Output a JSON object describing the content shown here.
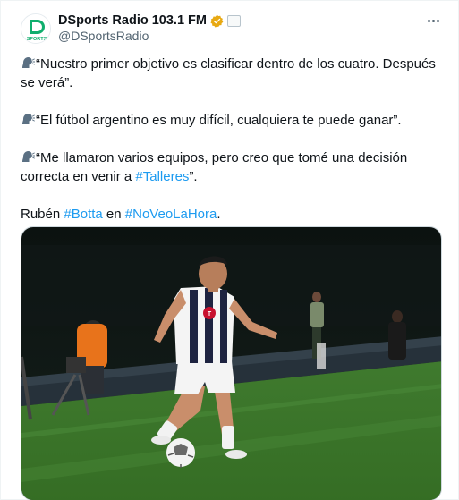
{
  "author": {
    "display_name": "DSports Radio 103.1 FM",
    "handle": "@DSportsRadio",
    "avatar_label": "SPORTS",
    "avatar_letter": "D"
  },
  "icons": {
    "verified": "verified-badge-gold",
    "affiliate": "affiliate-badge",
    "more": "more-options",
    "speaking": "speaking-head-emoji"
  },
  "colors": {
    "hashtag": "#1d9bf0",
    "verified": "#e8a912",
    "text": "#0f1419",
    "secondary": "#536471"
  },
  "tweet": {
    "quote1": "“Nuestro primer objetivo es clasificar dentro de los cuatro. Después se verá”.",
    "quote2": "“El fútbol argentino es muy difícil, cualquiera te puede ganar”.",
    "quote3_prefix": "“Me llamaron varios equipos, pero creo que tomé una decisión correcta en venir a ",
    "quote3_hashtag": "#Talleres",
    "quote3_suffix": "”.",
    "closing_name": "Rubén ",
    "closing_hashtag1": "#Botta",
    "closing_mid": " en ",
    "closing_hashtag2": "#NoVeoLaHora",
    "closing_end": "."
  },
  "media": {
    "jersey_text": "T"
  }
}
